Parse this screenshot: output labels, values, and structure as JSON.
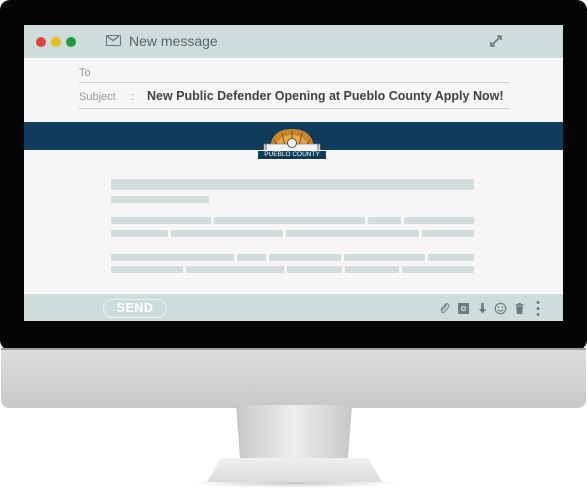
{
  "window": {
    "title": "New message",
    "traffic_lights": {
      "close": "#e0443e",
      "minimize": "#e8c020",
      "maximize": "#1f9c3c"
    }
  },
  "compose": {
    "to_label": "To",
    "to_value": "",
    "subject_label": "Subject",
    "subject_separator": ":",
    "subject_value": "New Public Defender Opening at Pueblo County Apply Now!"
  },
  "email_body": {
    "banner_color": "#0e3c5a",
    "logo_text": "PUEBLO COUNTY",
    "logo_icon": "pueblo-county-dome-logo"
  },
  "footer": {
    "send_label": "SEND",
    "tools": [
      "paperclip-icon",
      "image-icon",
      "download-icon",
      "emoji-icon",
      "trash-icon",
      "more-vertical-icon"
    ]
  },
  "colors": {
    "toolbar": "#cfdcdc",
    "placeholder": "#d3dddd",
    "screen_background": "#f6f6f6"
  }
}
